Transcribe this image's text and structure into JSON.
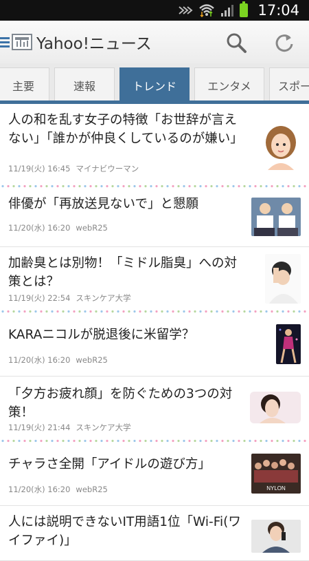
{
  "status": {
    "time": "17:04"
  },
  "app": {
    "title": "Yahoo!ニュース"
  },
  "tabs": [
    {
      "label": "主要"
    },
    {
      "label": "速報"
    },
    {
      "label": "トレンド",
      "active": true
    },
    {
      "label": "エンタメ"
    },
    {
      "label": "スポー"
    }
  ],
  "articles": [
    {
      "title": "人の和を乱す女子の特徴「お世辞が言えない」「誰かが仲良くしているのが嫌い」",
      "date": "11/19(火) 16:45",
      "source": "マイナビウーマン",
      "thumb": "illustrated-woman-portrait"
    },
    {
      "title": "俳優が「再放送見ないで」と懇願",
      "date": "11/20(水) 16:20",
      "source": "webR25",
      "thumb": "two-actors-holding-papers"
    },
    {
      "title": "加齢臭とは別物！「ミドル脂臭」への対策とは？",
      "date": "11/19(火) 22:54",
      "source": "スキンケア大学",
      "thumb": "man-holding-head"
    },
    {
      "title": "KARAニコルが脱退後に米留学？",
      "date": "11/20(水) 16:20",
      "source": "webR25",
      "thumb": "stage-performer"
    },
    {
      "title": "「夕方お疲れ顔」を防ぐための3つの対策！",
      "date": "11/19(火) 21:44",
      "source": "スキンケア大学",
      "thumb": "woman-face"
    },
    {
      "title": "チャラさ全開「アイドルの遊び方」",
      "date": "11/20(水) 16:20",
      "source": "webR25",
      "thumb": "group-photo-nylon",
      "thumb_text": "NYLON"
    },
    {
      "title": "人には説明できないIT用語1位「Wi-Fi(ワイファイ)」",
      "date": "",
      "source": "",
      "thumb": "man-with-phone"
    }
  ],
  "colors": {
    "accent": "#3f6f99",
    "status_bar": "#111111",
    "battery": "#7bd321"
  }
}
